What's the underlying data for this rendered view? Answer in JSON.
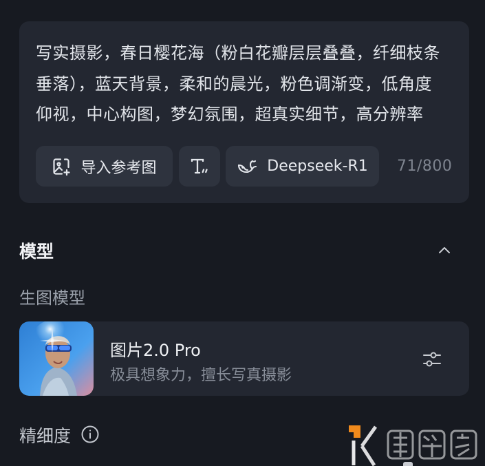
{
  "prompt": {
    "text": "写实摄影，春日樱花海（粉白花瓣层层叠叠，纤细枝条垂落），蓝天背景，柔和的晨光，粉色调渐变，低角度仰视，中心构图，梦幻氛围，超真实细节，高分辨率",
    "import_reference_label": "导入参考图",
    "text_style_icon": "text-format-icon",
    "reasoning_model_label": "Deepseek-R1",
    "char_count": "71/800"
  },
  "model_section": {
    "title": "模型",
    "subtitle": "生图模型",
    "model": {
      "name": "图片2.0 Pro",
      "description": "极具想象力，擅长写真摄影",
      "thumbnail_icon": "model-avatar-image"
    }
  },
  "detail_section": {
    "title": "精细度"
  },
  "watermark": {
    "text": "课学多"
  },
  "colors": {
    "background": "#171a21",
    "card": "#232731",
    "button": "#2e333e",
    "accent_orange": "#f08a1c"
  }
}
